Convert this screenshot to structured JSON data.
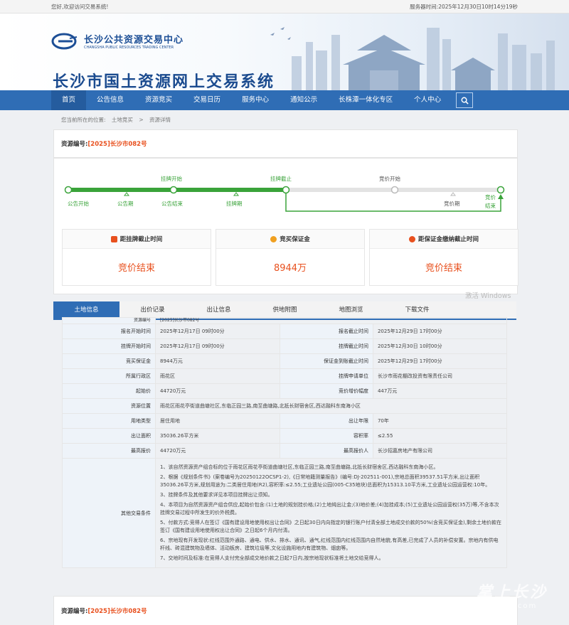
{
  "topbar": {
    "welcome": "您好,欢迎访问交易系统!",
    "server_time_label": "服务器时间:",
    "server_time": "2025年12月30日10时14分19秒"
  },
  "header": {
    "org_name": "长沙公共资源交易中心",
    "org_name_en": "CHANGSHA PUBLIC RESOURCES TRADING CENTER",
    "system_title": "长沙市国土资源网上交易系统"
  },
  "nav": {
    "items": [
      "首页",
      "公告信息",
      "资源竞买",
      "交易日历",
      "服务中心",
      "通知公示",
      "长株潭一体化专区",
      "个人中心"
    ]
  },
  "breadcrumb": {
    "prefix": "您当前所在的位置:",
    "level1": "土地竞买",
    "sep": ">",
    "level2": "资源详情"
  },
  "resource": {
    "code_label": "资源编号:",
    "code_value": "[2025]长沙市082号"
  },
  "progress": {
    "top_labels": [
      "挂牌开始",
      "挂牌截止",
      "竞价开始"
    ],
    "bottom_labels": [
      "公告开始",
      "公告期",
      "公告结束",
      "挂牌期",
      "竞价期",
      "竞价结束"
    ],
    "done_fraction": 0.5
  },
  "cards": [
    {
      "title": "距挂牌截止时间",
      "value": "竞价结束",
      "color": "#e8501e"
    },
    {
      "title": "竞买保证金",
      "value": "8944万",
      "color": "#f0a020"
    },
    {
      "title": "距保证金缴纳截止时间",
      "value": "竞价结束",
      "color": "#e8501e"
    }
  ],
  "tabs": [
    "土地信息",
    "出价记录",
    "出让信息",
    "供地附图",
    "地图浏览",
    "下载文件"
  ],
  "partial_row": {
    "label": "资源编号",
    "value": "[2025]长沙市082号"
  },
  "info_rows": [
    [
      "报名开始时间",
      "2025年12月17日 09时00分",
      "报名截止时间",
      "2025年12月29日 17时00分"
    ],
    [
      "挂牌开始时间",
      "2025年12月17日 09时00分",
      "挂牌截止时间",
      "2025年12月30日 10时00分"
    ],
    [
      "竞买保证金",
      "8944万元",
      "保证金到账截止时间",
      "2025年12月29日 17时00分"
    ],
    [
      "所属行政区",
      "雨花区",
      "挂牌申请单位",
      "长沙市雨花棚改投资有限责任公司"
    ],
    [
      "起始价",
      "44720万元",
      "竞价增价幅度",
      "447万元"
    ]
  ],
  "location": {
    "label": "资源位置",
    "value": "雨花区雨花亭街道曲塘社区,东临正园三路,南至曲塘路,北抵长财宿舍区,西达融科东南海小区"
  },
  "info_rows2": [
    [
      "用地类型",
      "居住用地",
      "出让年限",
      "70年"
    ],
    [
      "出让面积",
      "35036.26平方米",
      "容积率",
      "≤2.55"
    ],
    [
      "最高报价",
      "44720万元",
      "最高报价人",
      "长沙招嘉房地产有限公司"
    ]
  ],
  "other": {
    "label": "其他交易条件",
    "items": [
      "1、该自然资源资产组合标的位于雨花区雨花亭街道曲塘社区,东临正园三路,南至曲塘路,北抵长财宿舍区,西达融科东南海小区。",
      "2、根据《规划条件书》(案卷编号为20250122OCSP1-2),《日常地籍测量报告》(编号:DJ-202511-001),宗地总面积39537.51平方米,出让面积35036.26平方米,规划用途为:二类居住用地(R2),容积率:≤2.55;工业遗址公园(005-C35地块)总面积为15313.10平方米,工业遗址公园运营权:10年。",
      "3、挂牌条件及其他要求详见本项目挂牌出让须知。",
      "4、本项目为自然资源资产组合供应,起始价包含:(1)土地的规划挂价格;(2)土地纯出让金;(3)地价差;(4)加挂成本;(5)工业遗址公园运营权(35万)等,不含本次挂牌交易过程中所发生的价外税费。",
      "5、付款方式:竞得人在签订《国有建设用地使用权出让合同》之日起30日内向指定的银行账户付清全部土地成交价款的50%(含竞买保证金),剩余土地价款在签订《国有建设用地使用权出让合同》之日起6个月内付清。",
      "6、宗地现有开发现状:红线范围外通路、通电、供水、排水、通讯、通气,红线范围内红线范围内自然地貌,有高差,已完成了人员的补偿安置。宗地内有供电杆线、砖混建筑物及墙体、活动板房、建筑垃圾等,文化设施用地内有建筑物、烟囱等。",
      "7、交地时间及标准:在竞得人支付完全部成交地价款之日起7日内,按宗地现状标准将土地交给竞得人。"
    ]
  },
  "footer_code": {
    "label": "资源编号:",
    "value": "[2025]长沙市082号"
  },
  "watermark": "激活 Windows",
  "brand": {
    "name": "掌上长沙",
    "domain": "icswb.com"
  }
}
